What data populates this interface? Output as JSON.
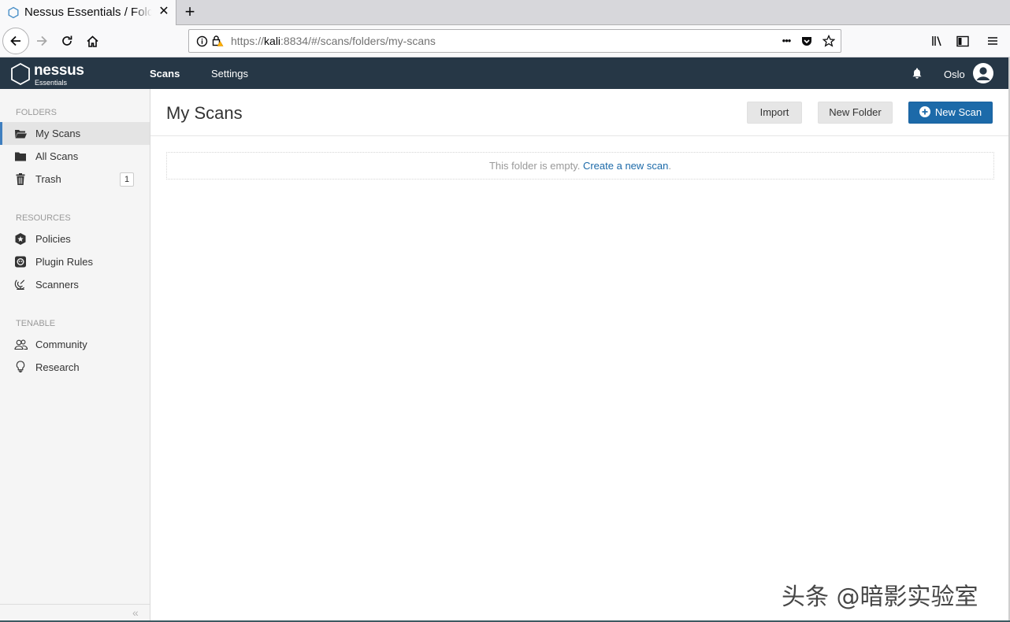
{
  "browser": {
    "tab_title": "Nessus Essentials / Folders / My Scans",
    "tab_close": "✕",
    "new_tab": "+",
    "url_scheme": "https://",
    "url_host": "kali",
    "url_rest": ":8834/#/scans/folders/my-scans",
    "url_more": "•••"
  },
  "header": {
    "logo_name": "nessus",
    "logo_sub": "Essentials",
    "nav": [
      {
        "label": "Scans"
      },
      {
        "label": "Settings"
      }
    ],
    "user": "Oslo"
  },
  "sidebar": {
    "folders_label": "FOLDERS",
    "folders": [
      {
        "label": "My Scans"
      },
      {
        "label": "All Scans"
      },
      {
        "label": "Trash",
        "badge": "1"
      }
    ],
    "resources_label": "RESOURCES",
    "resources": [
      {
        "label": "Policies"
      },
      {
        "label": "Plugin Rules"
      },
      {
        "label": "Scanners"
      }
    ],
    "tenable_label": "TENABLE",
    "tenable": [
      {
        "label": "Community"
      },
      {
        "label": "Research"
      }
    ],
    "collapse": "«"
  },
  "main": {
    "title": "My Scans",
    "import_label": "Import",
    "new_folder_label": "New Folder",
    "new_scan_label": "New Scan",
    "empty_text": "This folder is empty.",
    "empty_link": "Create a new scan",
    "empty_end": "."
  },
  "watermark": "头条 @暗影实验室",
  "colors": {
    "header_bg": "#263746",
    "primary": "#1c6aa9",
    "active_border": "#3f7fbf"
  }
}
